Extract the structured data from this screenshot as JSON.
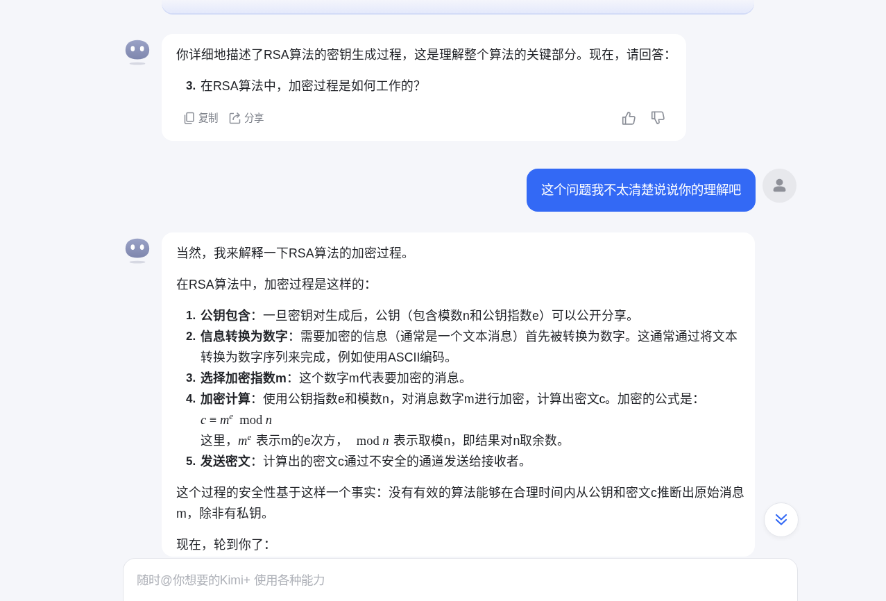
{
  "messages": [
    {
      "kind": "assistant",
      "blocks": [
        {
          "kind": "paragraph",
          "text": "你详细地描述了RSA算法的密钥生成过程，这是理解整个算法的关键部分。现在，请回答："
        },
        {
          "kind": "list",
          "items": [
            {
              "number": "3.",
              "text": "在RSA算法中，加密过程是如何工作的？"
            }
          ]
        }
      ],
      "actions": [
        {
          "kind": "copy",
          "label": "复制"
        },
        {
          "kind": "share",
          "label": "分享"
        },
        {
          "kind": "like"
        },
        {
          "kind": "dislike"
        }
      ]
    },
    {
      "kind": "user",
      "text": "这个问题我不太清楚说说你的理解吧"
    },
    {
      "kind": "assistant",
      "blocks": [
        {
          "kind": "paragraph",
          "text": "当然，我来解释一下RSA算法的加密过程。"
        },
        {
          "kind": "paragraph",
          "text": "在RSA算法中，加密过程是这样的："
        },
        {
          "kind": "list",
          "items": [
            {
              "number": "1.",
              "text": "**公钥包含**：一旦密钥对生成后，公钥（包含模数n和公钥指数e）可以公开分享。"
            },
            {
              "number": "2.",
              "text": "**信息转换为数字**：需要加密的信息（通常是一个文本消息）首先被转换为数字。这通常通过将文本转换为数字序列来完成，例如使用ASCII编码。"
            },
            {
              "number": "3.",
              "text": "**选择加密指数m**：这个数字m代表要加密的消息。"
            },
            {
              "number": "4.",
              "text": "**加密计算**：使用公钥指数e和模数n，对消息数字m进行加密，计算出密文c。加密的公式是：",
              "formula": "*c* ≡ *m*$^{e}$  mod *n*",
              "note": [
                {
                  "kind": "text",
                  "text": "这里，"
                },
                {
                  "kind": "math",
                  "text": "*m*$^{e}$"
                },
                {
                  "kind": "text",
                  "text": " 表示m的e次方，"
                },
                {
                  "kind": "math",
                  "text": "mod *n*"
                },
                {
                  "kind": "text",
                  "text": " 表示取模n，即结果对n取余数。"
                }
              ]
            },
            {
              "number": "5.",
              "text": "**发送密文**：计算出的密文c通过不安全的通道发送给接收者。"
            }
          ]
        },
        {
          "kind": "paragraph",
          "text": "这个过程的安全性基于这样一个事实：没有有效的算法能够在合理时间内从公钥和密文c推断出原始消息m，除非有私钥。"
        },
        {
          "kind": "paragraph",
          "text": "现在，轮到你了："
        }
      ]
    }
  ],
  "input": {
    "placeholder": "随时@你想要的Kimi+ 使用各种能力"
  }
}
